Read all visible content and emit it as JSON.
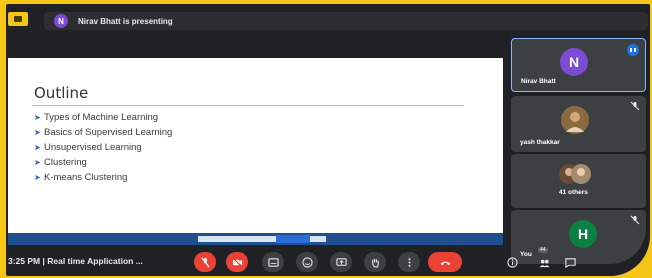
{
  "topbar": {
    "presenter_initial": "N",
    "presenting_text": "Nirav Bhatt is presenting"
  },
  "slide": {
    "title": "Outline",
    "bullets": [
      "Types of Machine Learning",
      "Basics of Supervised Learning",
      "Unsupervised Learning",
      "Clustering",
      "K-means Clustering"
    ]
  },
  "participants": [
    {
      "name": "Nirav Bhatt",
      "initial": "N",
      "avatar_color": "#7b4bd1",
      "speaking": true
    },
    {
      "name": "yash thakkar",
      "photo": true
    },
    {
      "name": "41 others",
      "group": true
    },
    {
      "name": "You",
      "initial": "H",
      "avatar_color": "#0b8043"
    }
  ],
  "bottombar": {
    "time_and_title": "3:25 PM  |  Real time Application ...",
    "others_badge": "44"
  },
  "colors": {
    "frame": "#f5c518",
    "meet_dark": "#202124",
    "tile": "#3c4043",
    "danger": "#ea4335"
  }
}
